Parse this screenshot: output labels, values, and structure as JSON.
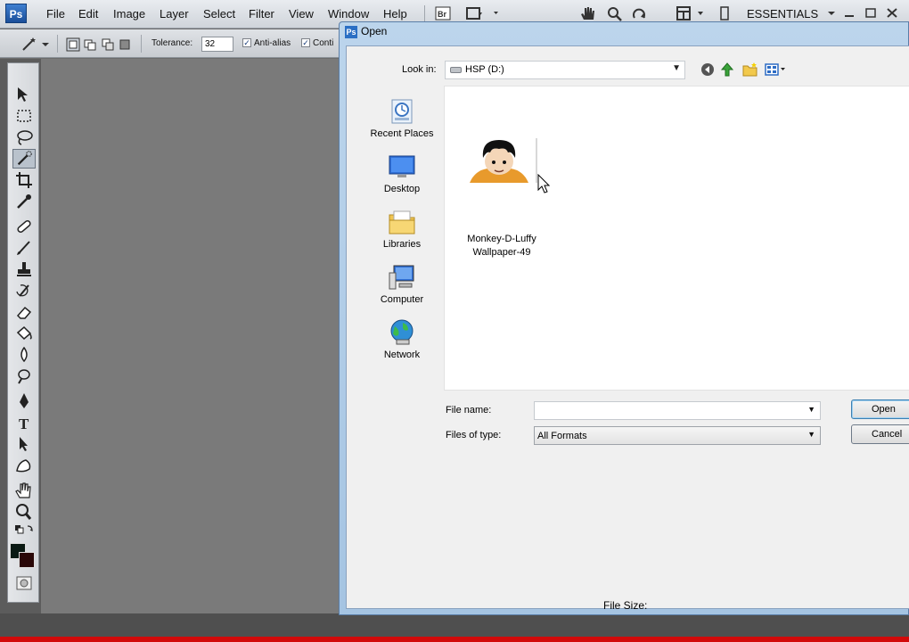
{
  "app": {
    "logo": "Ps",
    "workspace": "ESSENTIALS"
  },
  "menu": [
    "File",
    "Edit",
    "Image",
    "Layer",
    "Select",
    "Filter",
    "View",
    "Window",
    "Help"
  ],
  "options_bar": {
    "tolerance_label": "Tolerance:",
    "tolerance_value": "32",
    "antialias_label": "Anti-alias",
    "antialias_checked": "✓",
    "contiguous_label": "Conti",
    "contiguous_checked": "✓"
  },
  "tools": [
    "move-tool",
    "marquee-tool",
    "lasso-tool",
    "quick-selection-tool",
    "crop-tool",
    "eyedropper-tool",
    "healing-brush-tool",
    "brush-tool",
    "clone-stamp-tool",
    "history-brush-tool",
    "eraser-tool",
    "paint-bucket-tool",
    "blur-tool",
    "dodge-tool",
    "pen-tool",
    "type-tool",
    "path-selection-tool",
    "shape-tool",
    "hand-tool",
    "zoom-tool"
  ],
  "colors": {
    "foreground": "#0b1a14",
    "background": "#2a0808",
    "accent_red": "#d20a0a"
  },
  "dialog": {
    "title": "Open",
    "look_in_label": "Look in:",
    "look_in_value": "HSP (D:)",
    "places": [
      {
        "label": "Recent Places",
        "icon": "recent-places-icon"
      },
      {
        "label": "Desktop",
        "icon": "desktop-icon"
      },
      {
        "label": "Libraries",
        "icon": "libraries-icon"
      },
      {
        "label": "Computer",
        "icon": "computer-icon"
      },
      {
        "label": "Network",
        "icon": "network-icon"
      }
    ],
    "files": [
      {
        "name_line1": "Monkey-D-Luffy",
        "name_line2": "Wallpaper-49"
      }
    ],
    "file_name_label": "File name:",
    "file_name_value": "",
    "files_of_type_label": "Files of type:",
    "files_of_type_value": "All Formats",
    "open_button": "Open",
    "cancel_button": "Cancel",
    "file_size_label": "File Size:"
  }
}
